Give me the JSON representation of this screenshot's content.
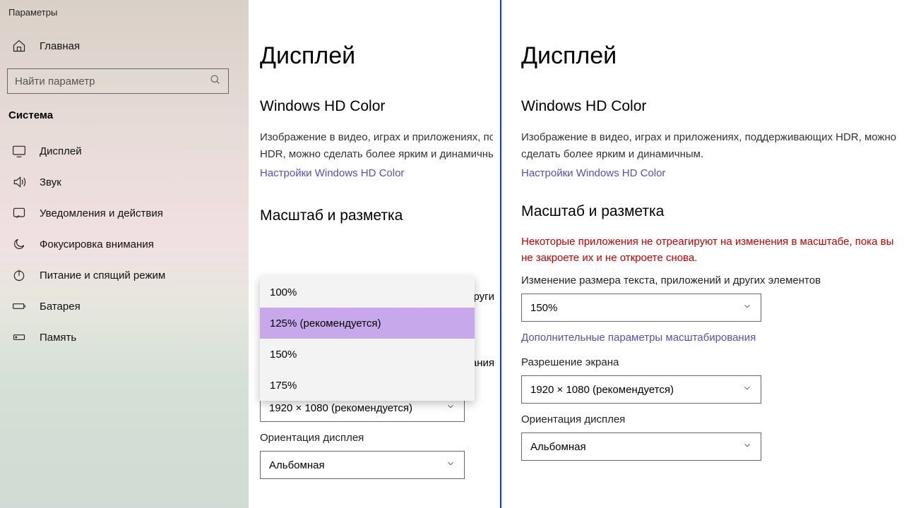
{
  "sidebar": {
    "title": "Параметры",
    "home": "Главная",
    "searchPlaceholder": "Найти параметр",
    "section": "Система",
    "items": [
      {
        "label": "Дисплей"
      },
      {
        "label": "Звук"
      },
      {
        "label": "Уведомления и действия"
      },
      {
        "label": "Фокусировка внимания"
      },
      {
        "label": "Питание и спящий режим"
      },
      {
        "label": "Батарея"
      },
      {
        "label": "Память"
      }
    ]
  },
  "left": {
    "heading": "Дисплей",
    "hdColor": "Windows HD Color",
    "hdDesc": "Изображение в видео, играх и приложениях, по… HDR, можно сделать более ярким и динамичны…",
    "hdLink": "Настройки Windows HD Color",
    "scale": "Масштаб и разметка",
    "options": [
      "100%",
      "125% (рекомендуется)",
      "150%",
      "175%"
    ],
    "fragmentRight1": "други",
    "fragmentRight2": "ания",
    "resolution": "1920 × 1080 (рекомендуется)",
    "orientationLabel": "Ориентация дисплея",
    "orientation": "Альбомная"
  },
  "right": {
    "heading": "Дисплей",
    "hdColor": "Windows HD Color",
    "hdDesc": "Изображение в видео, играх и приложениях, поддерживающих HDR, можно сделать более ярким и динамичным.",
    "hdLink": "Настройки Windows HD Color",
    "scale": "Масштаб и разметка",
    "warn": "Некоторые приложения не отреагируют на изменения в масштабе, пока вы не закроете их и не откроете снова.",
    "scaleLabel": "Изменение размера текста, приложений и других элементов",
    "scaleValue": "150%",
    "advanced": "Дополнительные параметры масштабирования",
    "resLabel": "Разрешение экрана",
    "resolution": "1920 × 1080 (рекомендуется)",
    "orientationLabel": "Ориентация дисплея",
    "orientation": "Альбомная"
  }
}
